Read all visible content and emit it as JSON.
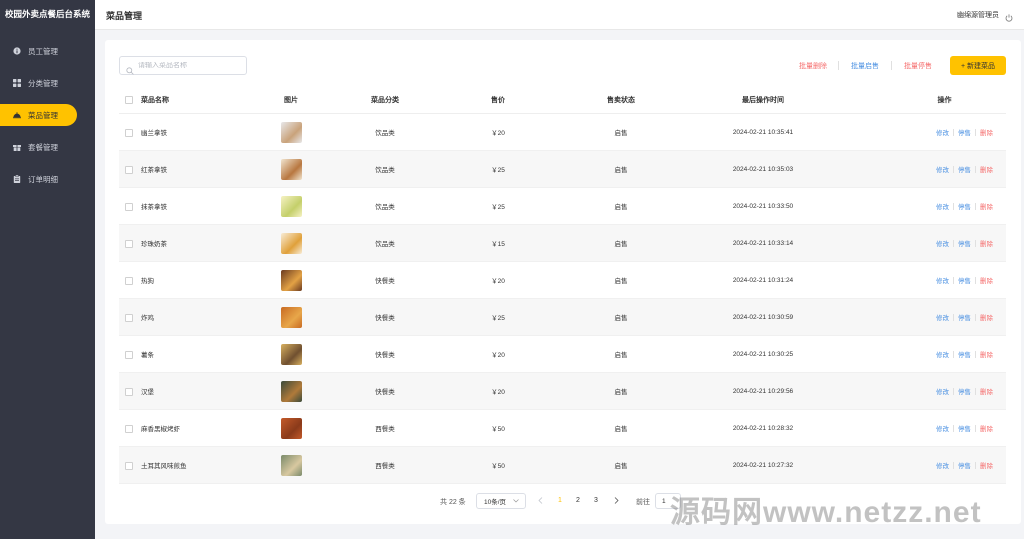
{
  "app": {
    "title": "校园外卖点餐后台系统"
  },
  "sidebar": {
    "items": [
      {
        "label": "员工管理",
        "icon": "info-icon"
      },
      {
        "label": "分类管理",
        "icon": "grid-icon"
      },
      {
        "label": "菜品管理",
        "icon": "dish-icon",
        "active": true
      },
      {
        "label": "套餐管理",
        "icon": "gift-icon"
      },
      {
        "label": "订单明细",
        "icon": "clipboard-icon"
      }
    ]
  },
  "header": {
    "title": "菜品管理",
    "user": "幽绵源管理员"
  },
  "toolbar": {
    "search_placeholder": "请输入菜品名称",
    "batch_delete": "批量删除",
    "batch_enable": "批量启售",
    "batch_disable": "批量停售",
    "add_button": "+ 新建菜品"
  },
  "table": {
    "columns": [
      "菜品名称",
      "图片",
      "菜品分类",
      "售价",
      "售卖状态",
      "最后操作时间",
      "操作"
    ],
    "actions": {
      "edit": "修改",
      "disable": "停售",
      "delete": "删除"
    },
    "rows": [
      {
        "name": "幽兰拿铁",
        "category": "饮品类",
        "price": "￥20",
        "status": "启售",
        "time": "2024-02-21 10:35:41",
        "img": [
          "#e8e8ea",
          "#c9a27a"
        ]
      },
      {
        "name": "红茶拿铁",
        "category": "饮品类",
        "price": "￥25",
        "status": "启售",
        "time": "2024-02-21 10:35:03",
        "img": [
          "#f1e5d0",
          "#b8773f"
        ]
      },
      {
        "name": "抹茶拿铁",
        "category": "饮品类",
        "price": "￥25",
        "status": "启售",
        "time": "2024-02-21 10:33:50",
        "img": [
          "#f6f2c4",
          "#c4cf6a"
        ]
      },
      {
        "name": "珍珠奶茶",
        "category": "饮品类",
        "price": "￥15",
        "status": "启售",
        "time": "2024-02-21 10:33:14",
        "img": [
          "#f8ecd6",
          "#e0a03a"
        ]
      },
      {
        "name": "热狗",
        "category": "快餐类",
        "price": "￥20",
        "status": "启售",
        "time": "2024-02-21 10:31:24",
        "img": [
          "#6a3a20",
          "#e3a245"
        ]
      },
      {
        "name": "炸鸡",
        "category": "快餐类",
        "price": "￥25",
        "status": "启售",
        "time": "2024-02-21 10:30:59",
        "img": [
          "#c86a22",
          "#e8a74a"
        ]
      },
      {
        "name": "薯条",
        "category": "快餐类",
        "price": "￥20",
        "status": "启售",
        "time": "2024-02-21 10:30:25",
        "img": [
          "#d8b060",
          "#705030"
        ]
      },
      {
        "name": "汉堡",
        "category": "快餐类",
        "price": "￥20",
        "status": "启售",
        "time": "2024-02-21 10:29:56",
        "img": [
          "#3a4a3a",
          "#b07a3a"
        ]
      },
      {
        "name": "麻香黑椒烤虾",
        "category": "西餐类",
        "price": "￥50",
        "status": "启售",
        "time": "2024-02-21 10:28:32",
        "img": [
          "#c45a2a",
          "#8a3a1a"
        ]
      },
      {
        "name": "土耳其风味煎鱼",
        "category": "西餐类",
        "price": "￥50",
        "status": "启售",
        "time": "2024-02-21 10:27:32",
        "img": [
          "#7a8a6a",
          "#d8c8a0"
        ]
      }
    ]
  },
  "pagination": {
    "total": "共 22 条",
    "page_size": "10条/页",
    "pages": [
      "1",
      "2",
      "3"
    ],
    "current": "1",
    "goto_label": "前往",
    "goto_value": "1"
  },
  "watermark": "源码网www.netzz.net",
  "colors": {
    "accent": "#ffc200",
    "sidebar": "#343744",
    "link_blue": "#4a90e2",
    "danger": "#f56c6c"
  }
}
